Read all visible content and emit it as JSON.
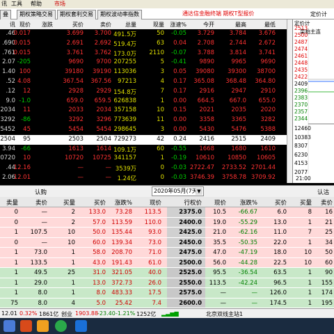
{
  "menubar": {
    "items": [
      "讯",
      "工具",
      "帮助",
      "市场"
    ]
  },
  "tabs": [
    "叠",
    "期权策略交易",
    "期权套利交易",
    "期权波动率指数"
  ],
  "tabbar": {
    "banner": "通达信金融终端  期权T型报价",
    "right": "定价计"
  },
  "quote": {
    "headers": [
      "讯",
      "现价",
      "涨跌",
      "买价",
      "卖价",
      "总量",
      "现量",
      "涨速%",
      "今开",
      "最高",
      "最低"
    ],
    "rows": [
      [
        ".46",
        "0.017",
        "3.699",
        "3.700",
        "491.5万",
        "50",
        "-0.05",
        "3.729",
        "3.784",
        "3.676"
      ],
      [
        ".690",
        "0.015",
        "2.691",
        "2.692",
        "519.4万",
        "63",
        "0.04",
        "2.708",
        "2.744",
        "2.672"
      ],
      [
        ".761",
        "0.015",
        "3.761",
        "3.762",
        "173.0万",
        "2110",
        "-0.07",
        "3.788",
        "3.814",
        "3.741"
      ],
      [
        "2.07",
        "-205",
        "9690",
        "9700",
        "207255",
        "5",
        "-0.41",
        "9890",
        "9965",
        "9690"
      ],
      [
        "1.40",
        "100",
        "39180",
        "39190",
        "113036",
        "3",
        "0.05",
        "39080",
        "39300",
        "38700"
      ],
      [
        ".52",
        "4.08",
        "367.54",
        "367.56",
        "97213",
        "4",
        "0.17",
        "365.08",
        "368.48",
        "364.80"
      ],
      [
        ".12",
        "12",
        "2928",
        "2929",
        "154.8万",
        "7",
        "0.17",
        "2916",
        "2947",
        "2910"
      ],
      [
        "9.0",
        "-1.0",
        "659.0",
        "659.5",
        "626838",
        "1",
        "0.00",
        "664.5",
        "667.0",
        "655.0"
      ],
      [
        "2034",
        "11",
        "2033",
        "2034",
        "357158",
        "10",
        "0.15",
        "2021",
        "2035",
        "2020"
      ],
      [
        "3292",
        "-86",
        "3292",
        "3296",
        "773639",
        "11",
        "0.00",
        "3358",
        "3365",
        "3282"
      ],
      [
        "5452",
        "45",
        "5454",
        "5454",
        "298645",
        "3",
        "0.00",
        "5430",
        "5476",
        "5388"
      ],
      [
        "2504",
        "95",
        "2503",
        "2504",
        "729273",
        "42",
        "0.24",
        "2416",
        "2515",
        "2409"
      ],
      [
        "3.94",
        "-66",
        "1613",
        "1614",
        "109.1万",
        "60",
        "-0.55",
        "1668",
        "1680",
        "1610"
      ],
      [
        "0720",
        "10",
        "10720",
        "10725",
        "341157",
        "1",
        "-0.19",
        "10610",
        "10850",
        "10605"
      ],
      [
        ".44",
        "12.16",
        "—",
        "—",
        "3539万",
        "0",
        "-0.03",
        "2722.47",
        "2733.52",
        "2701.44"
      ],
      [
        "2.06",
        "12.01",
        "—",
        "—",
        "1.24亿",
        "0",
        "-0.03",
        "3746.39",
        "3758.78",
        "3709.92"
      ]
    ]
  },
  "chart": {
    "title": "定价计",
    "contract": "菜粕主连",
    "y_labels": [
      "2513",
      "2500",
      "2487",
      "2474",
      "2461",
      "2448",
      "2435",
      "2422",
      "2409",
      "2396",
      "2383",
      "2370",
      "2357",
      "2344",
      "12460",
      "10383",
      "8307",
      "6230",
      "4153",
      "2077"
    ],
    "time": "21:00"
  },
  "tquote": {
    "call_label": "认购",
    "put_label": "认沽",
    "month": "2020年05月(7天)",
    "headers": [
      "卖量",
      "卖价",
      "买量",
      "买价",
      "涨跌%",
      "现价",
      "行权价",
      "现价",
      "涨跌%",
      "买价",
      "买量",
      "卖价"
    ],
    "rows": [
      [
        "0",
        "—",
        "2",
        "133.0",
        "73.28",
        "113.5",
        "2375.0",
        "10.5",
        "-66.67",
        "6.0",
        "8",
        "16"
      ],
      [
        "0",
        "—",
        "2",
        "57.0",
        "113.59",
        "110.0",
        "2400.0",
        "19.0",
        "-55.29",
        "13.0",
        "1",
        "21"
      ],
      [
        "1",
        "107.5",
        "10",
        "50.0",
        "135.44",
        "93.0",
        "2425.0",
        "21.0",
        "-62.16",
        "11.0",
        "7",
        "25"
      ],
      [
        "0",
        "—",
        "10",
        "60.0",
        "139.34",
        "73.0",
        "2450.0",
        "35.5",
        "-50.35",
        "22.0",
        "1",
        "34"
      ],
      [
        "1",
        "73.0",
        "1",
        "58.0",
        "208.70",
        "71.0",
        "2475.0",
        "47.0",
        "-47.19",
        "18.0",
        "10",
        "50"
      ],
      [
        "1",
        "133.5",
        "1",
        "43.0",
        "191.43",
        "61.0",
        "2500.0",
        "56.0",
        "-44.28",
        "22.5",
        "10",
        "60"
      ],
      [
        "1",
        "49.5",
        "25",
        "31.0",
        "321.05",
        "40.0",
        "2525.0",
        "95.5",
        "-36.54",
        "63.5",
        "1",
        "90"
      ],
      [
        "1",
        "29.0",
        "1",
        "13.0",
        "372.73",
        "26.0",
        "2550.0",
        "113.5",
        "-42.24",
        "96.5",
        "1",
        "155"
      ],
      [
        "1",
        "8.0",
        "1",
        "8.0",
        "483.33",
        "17.5",
        "2575.0",
        "—",
        "—",
        "126.0",
        "1",
        "174"
      ],
      [
        "75",
        "8.0",
        "4",
        "5.0",
        "25.42",
        "7.4",
        "2600.0",
        "—",
        "—",
        "174.5",
        "1",
        "195"
      ]
    ]
  },
  "status": {
    "i1_price": "12.01",
    "i1_pct": "0.32%",
    "i1_vol": "1861亿",
    "i2_name": "创业",
    "i2_price": "1903.88",
    "i2_chg": "-23.40",
    "i2_pct": "-1.21%",
    "i2_vol": "1252亿",
    "server": "北京双线主站1"
  },
  "colors": {
    "up": "#ff3232",
    "down": "#00d000",
    "call_bg": "#ffd9d9",
    "put_bg": "#c8e8c8"
  }
}
